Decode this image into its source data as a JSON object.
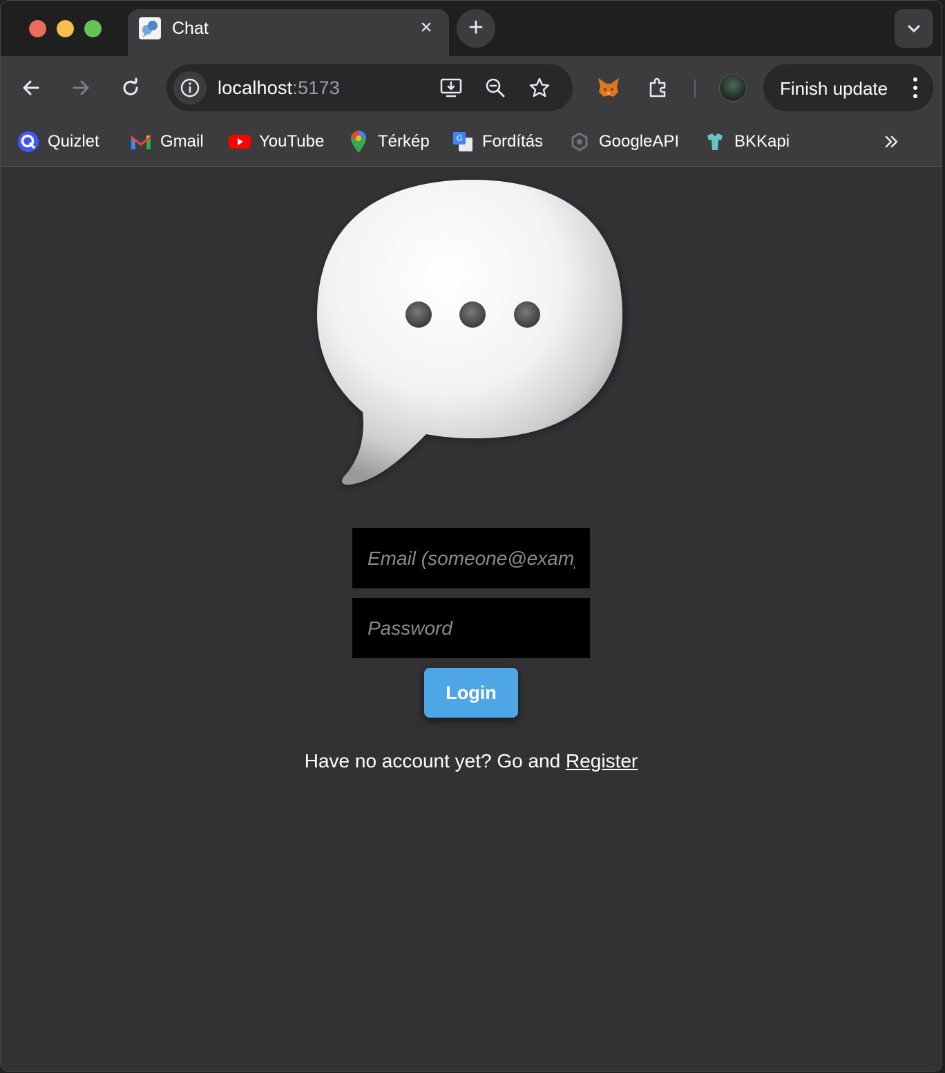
{
  "browser": {
    "tab": {
      "title": "Chat"
    },
    "omnibox": {
      "host": "localhost",
      "port": ":5173"
    },
    "update_button": {
      "label": "Finish update"
    },
    "bookmarks": [
      {
        "label": "Quizlet",
        "icon": "quizlet-icon"
      },
      {
        "label": "Gmail",
        "icon": "gmail-icon"
      },
      {
        "label": "YouTube",
        "icon": "youtube-icon"
      },
      {
        "label": "Térkép",
        "icon": "maps-icon"
      },
      {
        "label": "Fordítás",
        "icon": "translate-icon"
      },
      {
        "label": "GoogleAPI",
        "icon": "google-api-icon"
      },
      {
        "label": "BKKapi",
        "icon": "bkk-icon"
      }
    ]
  },
  "login": {
    "logo_icon": "speech-bubble-icon",
    "email_placeholder": "Email (someone@example.com)",
    "password_placeholder": "Password",
    "login_label": "Login",
    "register_prompt": "Have no account yet? Go and ",
    "register_link": "Register"
  },
  "colors": {
    "page_background": "#323235",
    "login_button": "#4ea6e6",
    "input_background": "#000000"
  }
}
